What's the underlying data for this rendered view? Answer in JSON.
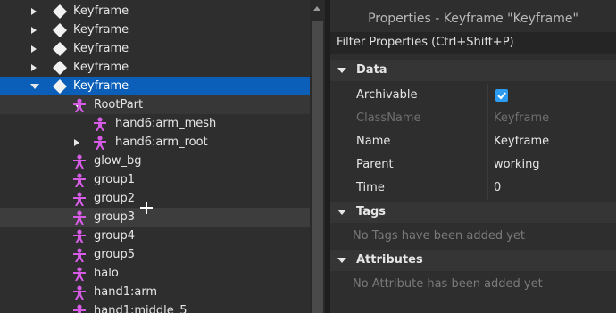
{
  "explorer": {
    "rows": [
      {
        "label": "Keyframe",
        "indent": 0,
        "arrow": "right",
        "icon": "keyframe-icon",
        "state": ""
      },
      {
        "label": "Keyframe",
        "indent": 0,
        "arrow": "right",
        "icon": "keyframe-icon",
        "state": ""
      },
      {
        "label": "Keyframe",
        "indent": 0,
        "arrow": "right",
        "icon": "keyframe-icon",
        "state": ""
      },
      {
        "label": "Keyframe",
        "indent": 0,
        "arrow": "right",
        "icon": "keyframe-icon",
        "state": ""
      },
      {
        "label": "Keyframe",
        "indent": 0,
        "arrow": "down",
        "icon": "keyframe-icon",
        "state": "selected"
      },
      {
        "label": "RootPart",
        "indent": 1,
        "arrow": "down",
        "icon": "pose-icon",
        "state": "alt"
      },
      {
        "label": "hand6:arm_mesh",
        "indent": 2,
        "arrow": "",
        "icon": "pose-icon",
        "state": ""
      },
      {
        "label": "hand6:arm_root",
        "indent": 2,
        "arrow": "right",
        "icon": "pose-icon",
        "state": ""
      },
      {
        "label": "glow_bg",
        "indent": 1,
        "arrow": "",
        "icon": "pose-icon",
        "state": ""
      },
      {
        "label": "group1",
        "indent": 1,
        "arrow": "",
        "icon": "pose-icon",
        "state": ""
      },
      {
        "label": "group2",
        "indent": 1,
        "arrow": "",
        "icon": "pose-icon",
        "state": ""
      },
      {
        "label": "group3",
        "indent": 1,
        "arrow": "",
        "icon": "pose-icon",
        "state": "hover"
      },
      {
        "label": "group4",
        "indent": 1,
        "arrow": "",
        "icon": "pose-icon",
        "state": ""
      },
      {
        "label": "group5",
        "indent": 1,
        "arrow": "",
        "icon": "pose-icon",
        "state": ""
      },
      {
        "label": "halo",
        "indent": 1,
        "arrow": "",
        "icon": "pose-icon",
        "state": ""
      },
      {
        "label": "hand1:arm",
        "indent": 1,
        "arrow": "",
        "icon": "pose-icon",
        "state": ""
      },
      {
        "label": "hand1:middle_5",
        "indent": 1,
        "arrow": "",
        "icon": "pose-icon",
        "state": ""
      }
    ]
  },
  "properties": {
    "title": "Properties - Keyframe \"Keyframe\"",
    "filter_placeholder": "Filter Properties (Ctrl+Shift+P)",
    "data_section": "Data",
    "props": [
      {
        "name": "Archivable",
        "value": "",
        "checkbox": true,
        "dim": false
      },
      {
        "name": "ClassName",
        "value": "Keyframe",
        "checkbox": false,
        "dim": true
      },
      {
        "name": "Name",
        "value": "Keyframe",
        "checkbox": false,
        "dim": false
      },
      {
        "name": "Parent",
        "value": "working",
        "checkbox": false,
        "dim": false
      },
      {
        "name": "Time",
        "value": "0",
        "checkbox": false,
        "dim": false
      }
    ],
    "tags_section": "Tags",
    "tags_empty": "No Tags have been added yet",
    "attributes_section": "Attributes",
    "attributes_empty": "No Attribute has been added yet"
  },
  "colors": {
    "selected": "#0b5fb8",
    "pose_icon": "#d65ce6",
    "checkbox": "#2d9bf0"
  }
}
